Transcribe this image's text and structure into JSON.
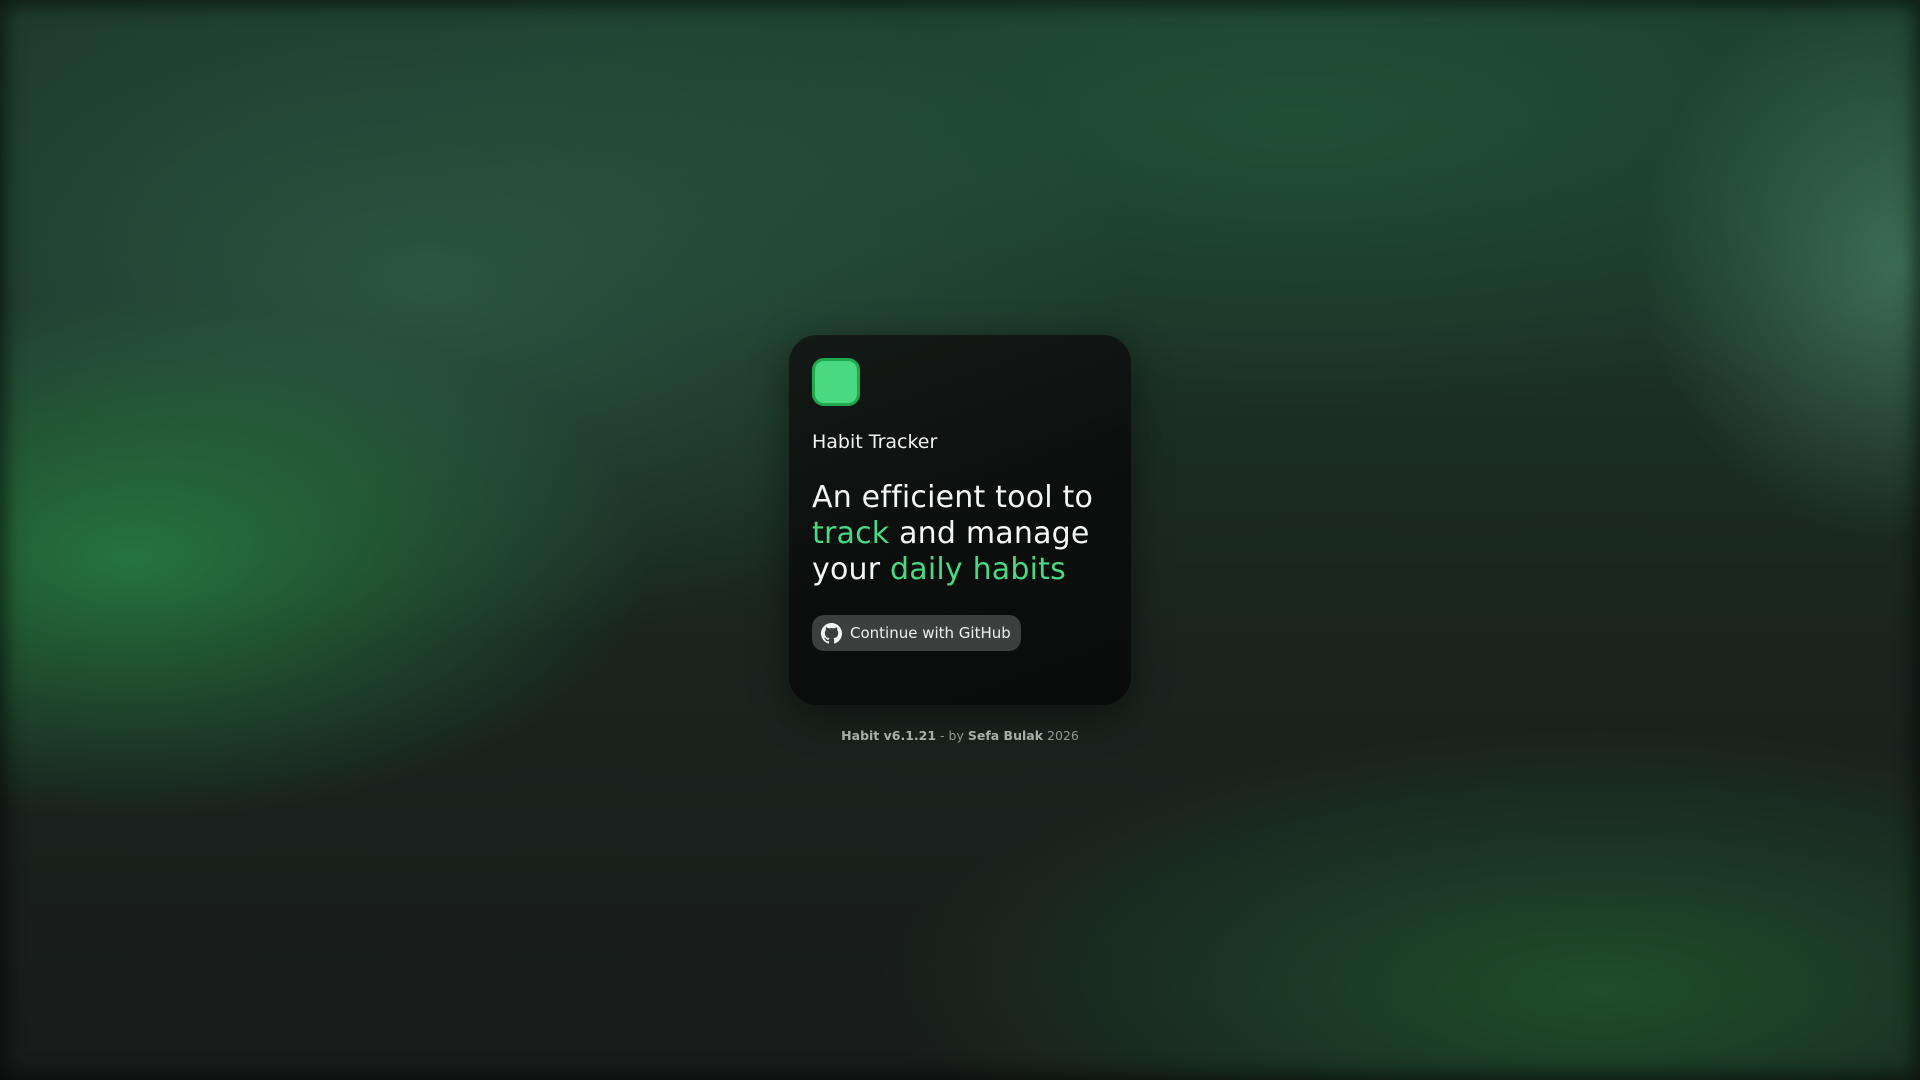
{
  "app": {
    "name": "Habit Tracker",
    "logo_icon": "app-logo-icon",
    "accent_color": "#4ad881"
  },
  "headline": {
    "part1": "An efficient tool to ",
    "highlight1": "track",
    "part2": " and manage your ",
    "highlight2": "daily habits"
  },
  "auth": {
    "github_label": "Continue with GitHub",
    "github_icon": "github-icon"
  },
  "footer": {
    "version": "Habit v6.1.21",
    "by_text": " - by ",
    "author": "Sefa Bulak",
    "year": " 2026"
  }
}
